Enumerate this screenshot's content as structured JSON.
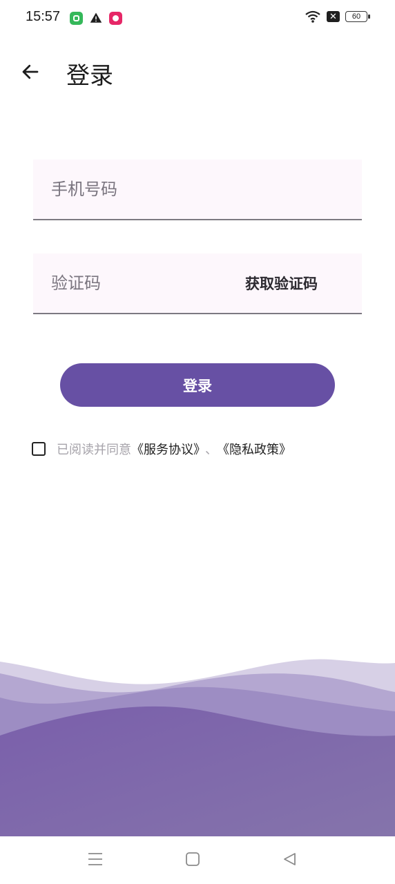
{
  "status_bar": {
    "time": "15:57",
    "battery_level": "60",
    "icons": [
      "green-app-icon",
      "warning-icon",
      "pink-app-icon",
      "wifi-icon",
      "close-box-icon",
      "battery-icon"
    ]
  },
  "app_bar": {
    "back_icon": "arrow-left-icon",
    "title": "登录"
  },
  "form": {
    "phone_placeholder": "手机号码",
    "phone_value": "",
    "code_placeholder": "验证码",
    "code_value": "",
    "get_code_label": "获取验证码",
    "login_label": "登录"
  },
  "agreement": {
    "checked": false,
    "prefix": "已阅读并同意",
    "service_link": "《服务协议》",
    "separator": "、",
    "privacy_link": "《隐私政策》"
  },
  "colors": {
    "primary": "#6750a4",
    "field_bg": "#fdf7fc",
    "hint_text": "#a6a3aa",
    "wave_light": "#c7bedb",
    "wave_dark": "#7a62a8"
  },
  "nav_bar": {
    "icons": [
      "menu-icon",
      "home-icon",
      "back-triangle-icon"
    ]
  }
}
